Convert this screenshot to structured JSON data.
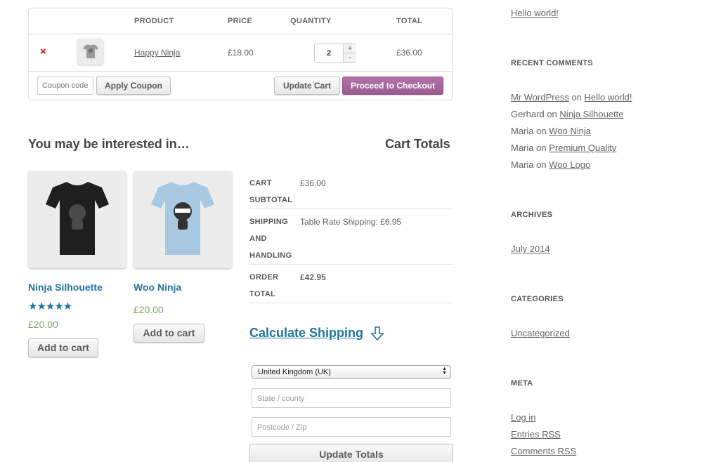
{
  "cart": {
    "headers": {
      "product": "PRODUCT",
      "price": "PRICE",
      "quantity": "QUANTITY",
      "total": "TOTAL"
    },
    "row": {
      "remove": "×",
      "name": "Happy Ninja",
      "price": "£18.00",
      "quantity": "2",
      "total": "£36.00"
    },
    "stepper": {
      "up": "+",
      "down": "-"
    },
    "coupon_placeholder": "Coupon code",
    "apply_coupon": "Apply Coupon",
    "update_cart": "Update Cart",
    "checkout": "Proceed to Checkout"
  },
  "cross_sells": {
    "title": "You may be interested in…",
    "products": [
      {
        "name": "Ninja Silhouette",
        "stars": "★★★★★",
        "rating": 5,
        "price": "£20.00",
        "button": "Add to cart",
        "shirt_color": "#1f1f1f"
      },
      {
        "name": "Woo Ninja",
        "price": "£20.00",
        "button": "Add to cart",
        "shirt_color": "#a9c9e3"
      }
    ]
  },
  "totals": {
    "title": "Cart Totals",
    "rows": [
      {
        "label": [
          "CART",
          "SUBTOTAL"
        ],
        "value": "£36.00"
      },
      {
        "label": [
          "SHIPPING",
          "AND",
          "HANDLING"
        ],
        "value": "Table Rate Shipping: £6.95"
      },
      {
        "label": [
          "ORDER",
          "TOTAL"
        ],
        "value": "£42.95"
      }
    ],
    "calc_shipping": "Calculate Shipping",
    "country": "United Kingdom (UK)",
    "state_placeholder": "State / county",
    "postcode_placeholder": "Postcode / Zip",
    "update_totals": "Update Totals"
  },
  "sidebar": {
    "recent_post": "Hello world!",
    "recent_comments_title": "RECENT COMMENTS",
    "comments": [
      {
        "author": "Mr WordPress",
        "on": "on",
        "post": "Hello world!"
      },
      {
        "author": "Gerhard",
        "on": "on",
        "post": "Ninja Silhouette"
      },
      {
        "author": "Maria",
        "on": "on",
        "post": "Woo Ninja"
      },
      {
        "author": "Maria",
        "on": "on",
        "post": "Premium Quality"
      },
      {
        "author": "Maria",
        "on": "on",
        "post": "Woo Logo"
      }
    ],
    "archives_title": "ARCHIVES",
    "archive": "July 2014",
    "categories_title": "CATEGORIES",
    "category": "Uncategorized",
    "meta_title": "META",
    "meta_links": [
      "Log in",
      "Entries RSS",
      "Comments RSS"
    ]
  },
  "colors": {
    "accent": "#21759b",
    "checkout": "#a46497",
    "price": "#77a464",
    "remove": "#dd0000"
  }
}
